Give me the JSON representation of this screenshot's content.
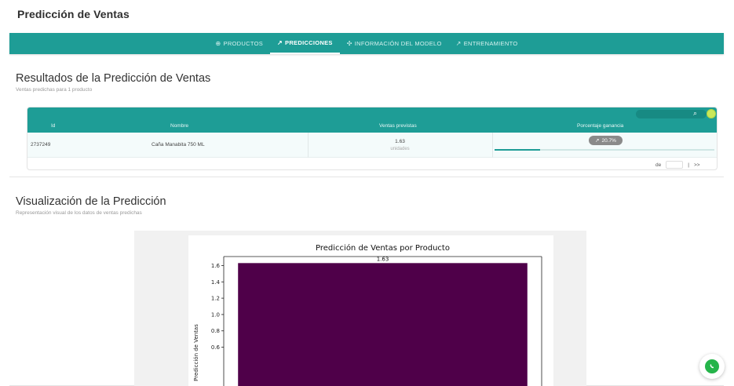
{
  "app": {
    "title": "Predicción de Ventas"
  },
  "nav": {
    "tabs": [
      {
        "icon": "plus-circle-icon",
        "glyph": "⊕",
        "label": "PRODUCTOS",
        "active": false
      },
      {
        "icon": "trend-icon",
        "glyph": "↗",
        "label": "PREDICCIONES",
        "active": true
      },
      {
        "icon": "model-icon",
        "glyph": "✣",
        "label": "INFORMACIÓN DEL MODELO",
        "active": false
      },
      {
        "icon": "trend-icon",
        "glyph": "↗",
        "label": "ENTRENAMIENTO",
        "active": false
      }
    ]
  },
  "results": {
    "title": "Resultados de la Predicción de Ventas",
    "subtitle": "Ventas predichas para 1 producto",
    "table": {
      "headers": {
        "id": "Id",
        "name": "Nombre",
        "sales": "Ventas previstas",
        "margin": "Porcentaje ganancia"
      },
      "rows": [
        {
          "id": "2737249",
          "name": "Caña Manabita 750 ML",
          "sales": "1.63",
          "unit": "unidades",
          "margin": "20.7%",
          "margin_fraction": 0.207
        }
      ],
      "pager": {
        "of_label": "de",
        "separator": "|",
        "next_label": ">>"
      }
    }
  },
  "visualization": {
    "title": "Visualización de la Predicción",
    "subtitle": "Representación visual de los datos de ventas predichas"
  },
  "colors": {
    "accent": "#1e9d96",
    "bar": "#4f0049",
    "whatsapp": "#25b44a"
  },
  "chart_data": {
    "type": "bar",
    "title": "Predicción de Ventas por Producto",
    "ylabel": "Predicción de Ventas",
    "xlabel": "",
    "categories": [
      ""
    ],
    "values": [
      1.63
    ],
    "data_labels": [
      "1.63"
    ],
    "y_ticks": [
      "0.6",
      "0.8",
      "1.0",
      "1.2",
      "1.4",
      "1.6"
    ],
    "y_tick_values": [
      0.6,
      0.8,
      1.0,
      1.2,
      1.4,
      1.6
    ],
    "ylim": [
      0,
      1.71
    ],
    "grid": false
  }
}
